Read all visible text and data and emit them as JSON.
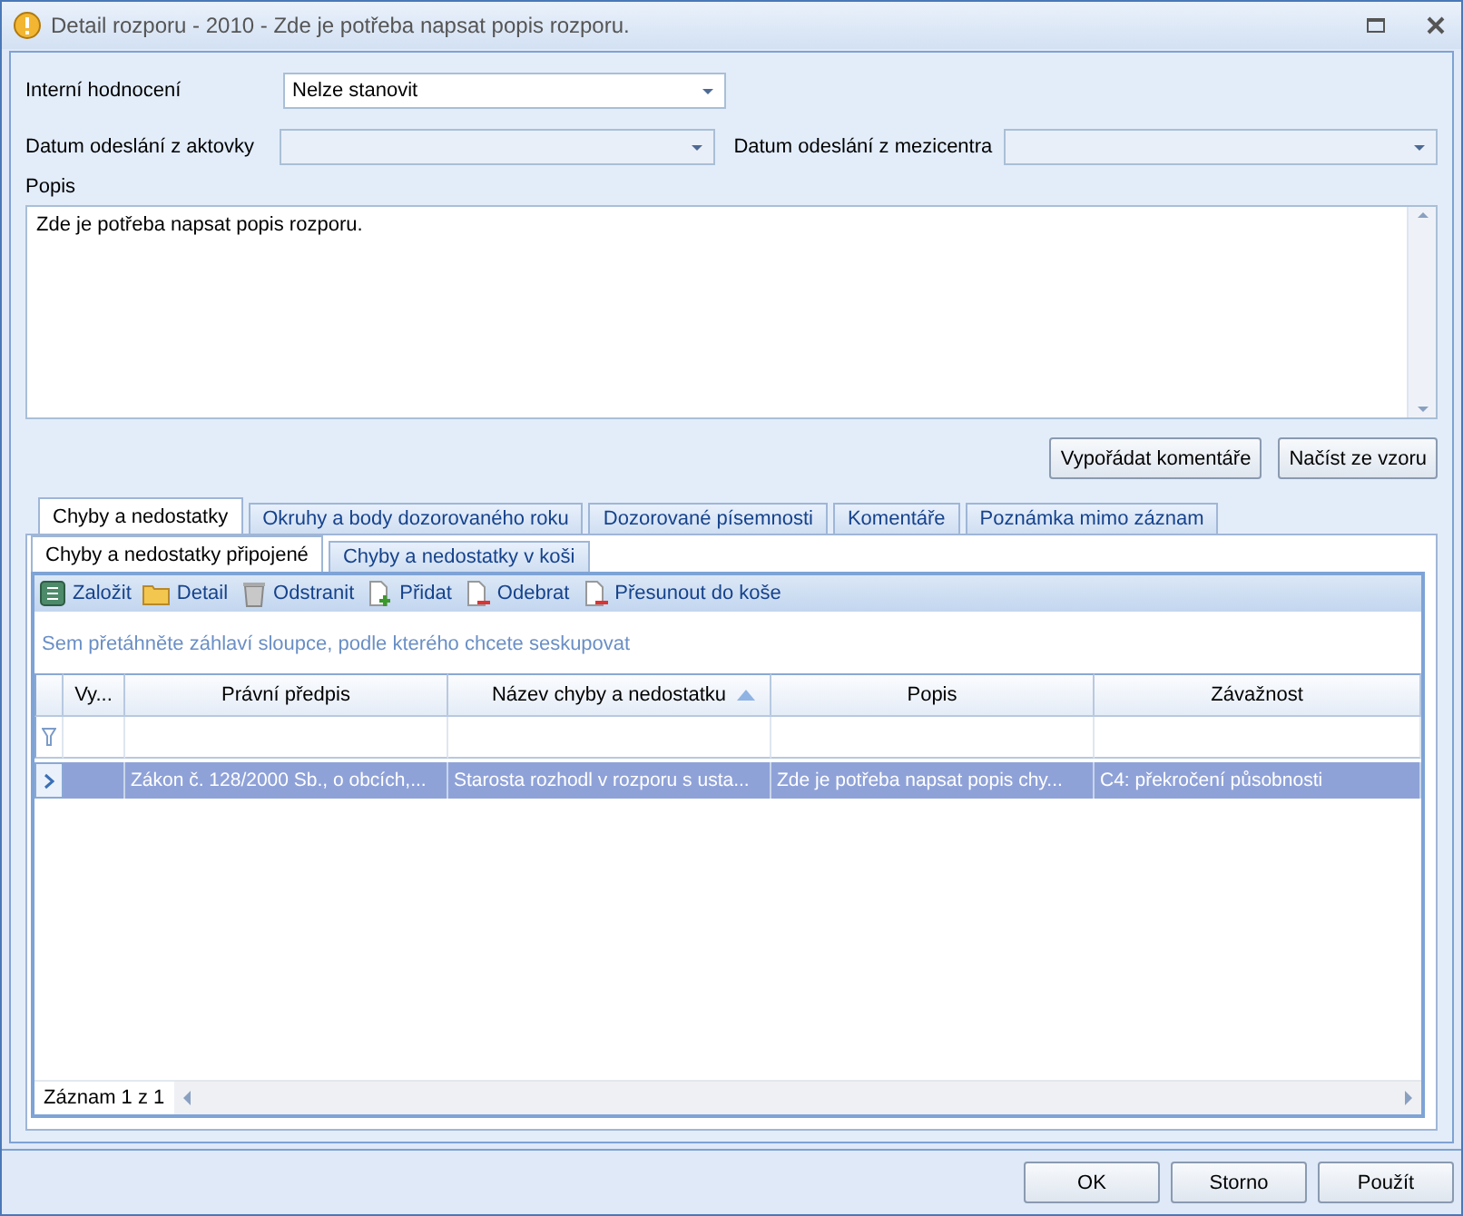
{
  "window": {
    "title": "Detail rozporu - 2010 - Zde je potřeba napsat popis rozporu."
  },
  "internal_rating": {
    "label": "Interní hodnocení",
    "value": "Nelze stanovit"
  },
  "dates": [
    {
      "label": "Datum odeslání z aktovky"
    },
    {
      "label": "Datum odeslání z mezicentra"
    }
  ],
  "description": {
    "label": "Popis",
    "value": "Zde je potřeba napsat popis rozporu."
  },
  "action_buttons": [
    "Vypořádat komentáře",
    "Načíst ze vzoru"
  ],
  "tabs": [
    {
      "label": "Chyby a nedostatky",
      "selected": true
    },
    {
      "label": "Okruhy a body dozorovaného roku",
      "selected": false
    },
    {
      "label": "Dozorované písemnosti",
      "selected": false
    },
    {
      "label": "Komentáře",
      "selected": false
    },
    {
      "label": "Poznámka mimo záznam",
      "selected": false
    }
  ],
  "subtabs": [
    {
      "label": "Chyby a nedostatky připojené",
      "selected": true
    },
    {
      "label": "Chyby a nedostatky v koši",
      "selected": false
    }
  ],
  "toolbar": [
    {
      "label": "Založit",
      "kind": "new"
    },
    {
      "label": "Detail",
      "kind": "folder"
    },
    {
      "label": "Odstranit",
      "kind": "trash"
    },
    {
      "label": "Přidat",
      "kind": "add"
    },
    {
      "label": "Odebrat",
      "kind": "remove"
    },
    {
      "label": "Přesunout do koše",
      "kind": "remove"
    }
  ],
  "grid": {
    "group_hint": "Sem přetáhněte záhlaví sloupce, podle kterého chcete seskupovat",
    "columns": [
      {
        "label": "Vy...",
        "sorted": false
      },
      {
        "label": "Právní předpis",
        "sorted": false
      },
      {
        "label": "Název chyby a nedostatku",
        "sorted": true
      },
      {
        "label": "Popis",
        "sorted": false
      },
      {
        "label": "Závažnost",
        "sorted": false
      }
    ],
    "rows": [
      {
        "selected": true,
        "cells": [
          null,
          "Zákon č. 128/2000 Sb., o obcích,...",
          "Starosta rozhodl v rozporu s usta...",
          "Zde je potřeba napsat popis chy...",
          "C4: překročení působnosti"
        ]
      }
    ],
    "record_count": "Záznam 1 z 1"
  },
  "buttons": [
    "OK",
    "Storno",
    "Použít"
  ]
}
